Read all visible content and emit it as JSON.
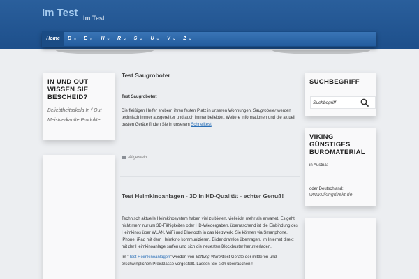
{
  "header": {
    "site_title": "Im Test",
    "tagline": "Im Test",
    "nav": [
      {
        "label": "Home"
      },
      {
        "label": "B"
      },
      {
        "label": "E"
      },
      {
        "label": "H"
      },
      {
        "label": "R"
      },
      {
        "label": "S"
      },
      {
        "label": "U"
      },
      {
        "label": "V"
      },
      {
        "label": "Z"
      }
    ]
  },
  "left_widget": {
    "title": "IN UND OUT – WISSEN SIE BESCHEID?",
    "links": [
      "Beliebtheitsskala In / Out",
      "Meistverkaufte Produkte"
    ]
  },
  "posts": [
    {
      "title": "Test Saugroboter",
      "lead": "Test Saugroboter",
      "lead_suffix": ":",
      "body_1": "Die fleißigen Helfer erobern ihren festen Platz in unseren Wohnungen. ",
      "body_em": "Saugroboter",
      "body_2": " werden technisch immer ausgereifter und auch immer beliebter. Weitere Informationen und die aktuell besten Geräte finden Sie in unserem ",
      "link": "Schnelltest",
      "body_3": ".",
      "category": "Allgemein"
    },
    {
      "title": "Test Heimkinoanlagen - 3D in HD-Qualität - echter Genuß!",
      "body_1": "Technisch aktuelle Heimkinosystem haben viel zu bieten, vielleicht mehr als erwartet. Es geht nicht mehr nur um 3D-Fähigkeiten oder HD-Wiedergaben, überraschend ist die Einbindung des Heimkinos über WLAN, WiFi und Bluetooth in das Netzwerk. Sie können via Smartphone, iPhone, iPad mit dem Heimkino kommunizieren, Bilder drahtlos übertragen, im Internet direkt mit der Heimkinoanlage surfen und sich die neuesten Blockbuster herunterladen.",
      "p2_prefix": "Im \"",
      "p2_link": "Test Heimkinoanlagen",
      "p2_mid": "\" werden von ",
      "p2_em": "Stiftung Warentest",
      "p2_rest": " Geräte der mittleren und erschwinglichen Preisklasse vorgestellt. Lassen Sie sich überraschen !"
    }
  ],
  "search_widget": {
    "title": "SUCHBEGRIFF",
    "value": "Suchbegriff"
  },
  "viking_widget": {
    "title": "VIKING – GÜNSTIGES BÜROMATERIAL",
    "line1": "in Austria:",
    "line2": "oder Deutschland:",
    "link": "www.vikingdirekt.de"
  }
}
